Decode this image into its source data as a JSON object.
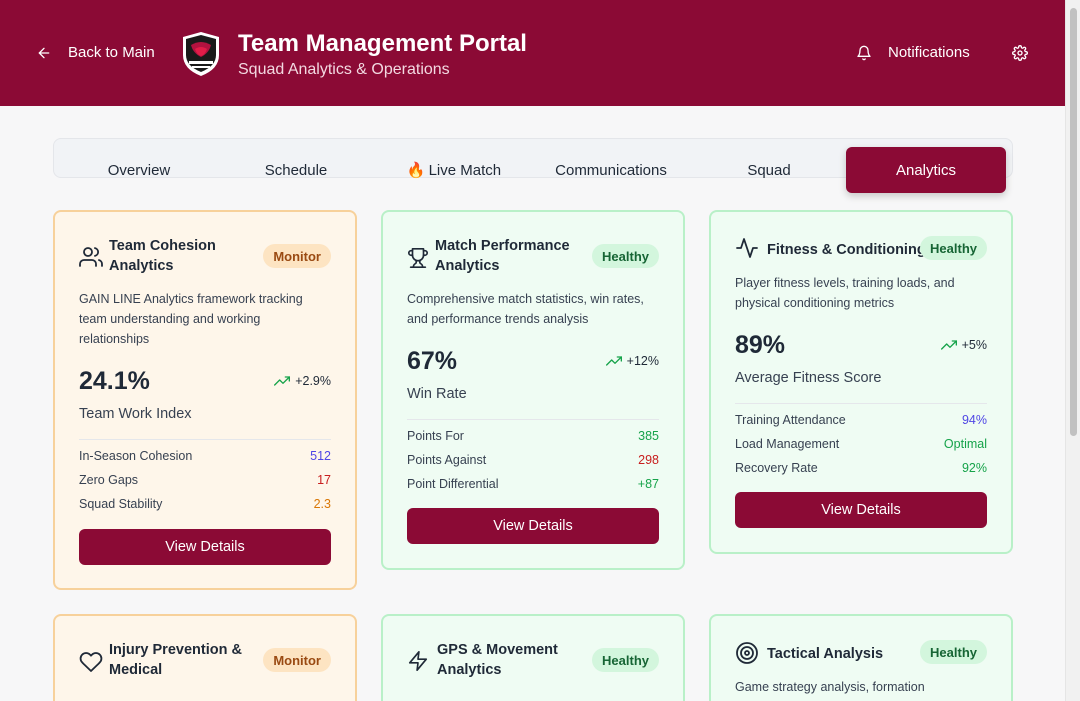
{
  "header": {
    "back_label": "Back to Main",
    "title": "Team Management Portal",
    "subtitle": "Squad Analytics & Operations",
    "notifications_label": "Notifications"
  },
  "tabs": [
    {
      "label": "Overview",
      "active": false
    },
    {
      "label": "Schedule",
      "active": false
    },
    {
      "label": "Live Match",
      "icon": "🔥",
      "active": false
    },
    {
      "label": "Communications",
      "active": false
    },
    {
      "label": "Squad",
      "active": false
    },
    {
      "label": "Analytics",
      "active": true
    }
  ],
  "cards": [
    {
      "title_line1": "Team Cohesion",
      "title_line2": "Analytics",
      "badge": "Monitor",
      "status": "monitor",
      "icon": "users-icon",
      "desc": [
        "GAIN LINE Analytics framework tracking",
        "team understanding and working",
        "relationships"
      ],
      "value": "24.1%",
      "trend": "+2.9%",
      "metric": "Team Work Index",
      "rows": [
        {
          "label": "In-Season Cohesion",
          "value": "512",
          "color": "#4f46e5"
        },
        {
          "label": "Zero Gaps",
          "value": "17",
          "color": "#c81e1e"
        },
        {
          "label": "Squad Stability",
          "value": "2.3",
          "color": "#d97706"
        }
      ],
      "button": "View Details"
    },
    {
      "title_line1": "Match Performance",
      "title_line2": "Analytics",
      "badge": "Healthy",
      "status": "healthy",
      "icon": "trophy-icon",
      "desc": [
        "Comprehensive match statistics, win rates,",
        "and performance trends analysis"
      ],
      "value": "67%",
      "trend": "+12%",
      "metric": "Win Rate",
      "rows": [
        {
          "label": "Points For",
          "value": "385",
          "color": "#16a34a"
        },
        {
          "label": "Points Against",
          "value": "298",
          "color": "#c81e1e"
        },
        {
          "label": "Point Differential",
          "value": "+87",
          "color": "#16a34a"
        }
      ],
      "button": "View Details"
    },
    {
      "title_line1": "Fitness & Conditioning",
      "title_line2": "",
      "badge": "Healthy",
      "status": "healthy",
      "icon": "activity-icon",
      "desc": [
        "Player fitness levels, training loads, and",
        "physical conditioning metrics"
      ],
      "value": "89%",
      "trend": "+5%",
      "metric": "Average Fitness Score",
      "rows": [
        {
          "label": "Training Attendance",
          "value": "94%",
          "color": "#4f46e5"
        },
        {
          "label": "Load Management",
          "value": "Optimal",
          "color": "#16a34a"
        },
        {
          "label": "Recovery Rate",
          "value": "92%",
          "color": "#16a34a"
        }
      ],
      "button": "View Details"
    },
    {
      "title_line1": "Injury Prevention &",
      "title_line2": "Medical",
      "badge": "Monitor",
      "status": "monitor",
      "icon": "heart-icon",
      "desc": []
    },
    {
      "title_line1": "GPS & Movement",
      "title_line2": "Analytics",
      "badge": "Healthy",
      "status": "healthy",
      "icon": "zap-icon",
      "desc": []
    },
    {
      "title_line1": "Tactical Analysis",
      "title_line2": "",
      "badge": "Healthy",
      "status": "healthy",
      "icon": "target-icon",
      "desc": [
        "Game strategy analysis, formation"
      ]
    }
  ]
}
